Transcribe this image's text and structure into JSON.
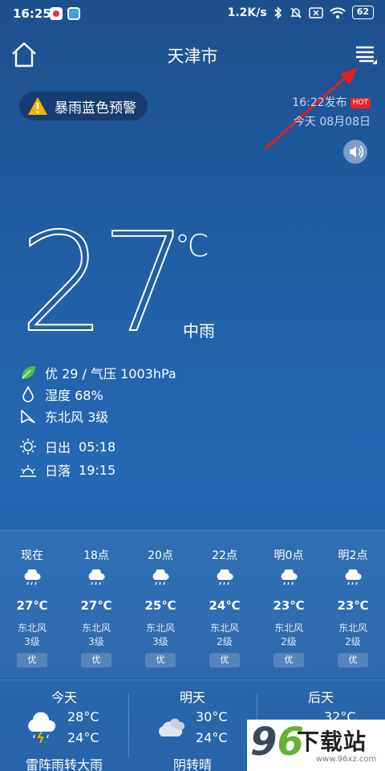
{
  "status": {
    "time": "16:25",
    "net_speed": "1.2K/s",
    "battery": "62"
  },
  "header": {
    "city": "天津市"
  },
  "alert": {
    "label": "暴雨蓝色预警"
  },
  "publish": {
    "time_text": "16:22发布",
    "hot": "HOT",
    "date_text": "今天 08月08日"
  },
  "current": {
    "temp": "27",
    "unit": "℃",
    "condition": "中雨"
  },
  "details": {
    "aqi_pressure": "优 29 / 气压 1003hPa",
    "humidity": "湿度 68%",
    "wind": "东北风 3级",
    "sunrise_label": "日出",
    "sunrise": "05:18",
    "sunset_label": "日落",
    "sunset": "19:15"
  },
  "hourly": [
    {
      "label": "现在",
      "temp": "27℃",
      "wind_dir": "东北风",
      "wind_lvl": "3级",
      "aqi": "优",
      "icon": "rain-cloud-icon"
    },
    {
      "label": "18点",
      "temp": "27℃",
      "wind_dir": "东北风",
      "wind_lvl": "3级",
      "aqi": "优",
      "icon": "rain-cloud-icon"
    },
    {
      "label": "20点",
      "temp": "25℃",
      "wind_dir": "东北风",
      "wind_lvl": "3级",
      "aqi": "优",
      "icon": "rain-cloud-icon"
    },
    {
      "label": "22点",
      "temp": "24℃",
      "wind_dir": "东北风",
      "wind_lvl": "2级",
      "aqi": "优",
      "icon": "rain-cloud-icon"
    },
    {
      "label": "明0点",
      "temp": "23℃",
      "wind_dir": "东北风",
      "wind_lvl": "2级",
      "aqi": "优",
      "icon": "rain-cloud-icon"
    },
    {
      "label": "明2点",
      "temp": "23℃",
      "wind_dir": "东北风",
      "wind_lvl": "2级",
      "aqi": "优",
      "icon": "rain-cloud-icon"
    }
  ],
  "daily": [
    {
      "name": "今天",
      "hi": "28°C",
      "lo": "24°C",
      "desc": "雷阵雨转大雨",
      "icon": "thunderstorm-icon"
    },
    {
      "name": "明天",
      "hi": "30°C",
      "lo": "24°C",
      "desc": "阴转晴",
      "icon": "cloudy-icon"
    },
    {
      "name": "后天",
      "hi": "32°C",
      "lo": "",
      "desc": "",
      "icon": "sunny-icon"
    }
  ],
  "watermark": {
    "digits_a": "9",
    "digits_b": "6",
    "text": "下载站",
    "url": "www.96xz.com"
  },
  "colors": {
    "background": "#2568b3",
    "alert_triangle": "#f4b400",
    "hot_badge": "#e22222",
    "arrow": "#e32020",
    "leaf": "#4fc04f"
  }
}
